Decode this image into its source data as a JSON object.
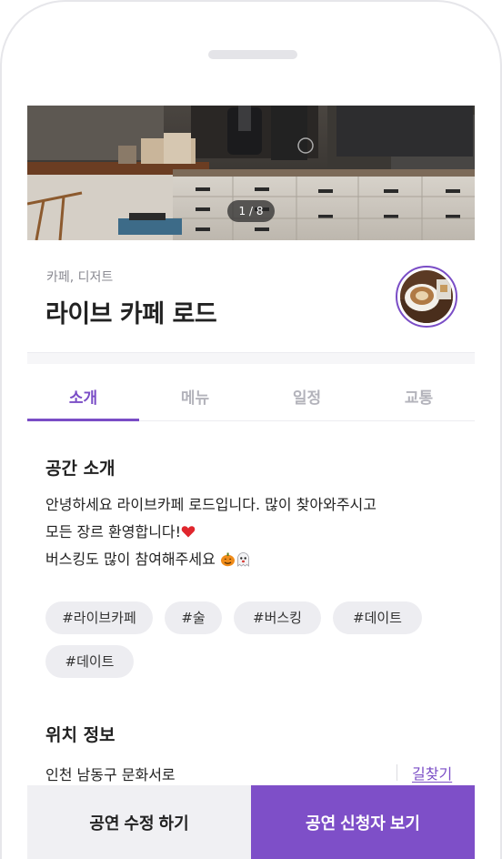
{
  "hero": {
    "counter": "1 / 8"
  },
  "place": {
    "category": "카페, 디저트",
    "name": "라이브 카페 로드"
  },
  "tabs": [
    {
      "label": "소개",
      "active": true
    },
    {
      "label": "메뉴",
      "active": false
    },
    {
      "label": "일정",
      "active": false
    },
    {
      "label": "교통",
      "active": false
    }
  ],
  "intro": {
    "title": "공간 소개",
    "lines": [
      "안녕하세요 라이브카페 로드입니다. 많이 찾아와주시고",
      "모든 장르 환영합니다!",
      "버스킹도 많이 참여해주세요 "
    ],
    "tags": [
      "#라이브카페",
      "#술",
      "#버스킹",
      "#데이트",
      "#데이트"
    ]
  },
  "location": {
    "title": "위치 정보",
    "address": "인천 남동구 문화서로",
    "directions_label": "길찾기"
  },
  "actions": {
    "edit_label": "공연 수정 하기",
    "apply_label": "공연 신청자 보기"
  },
  "colors": {
    "accent": "#7e4fc8",
    "tag_bg": "#ededf1",
    "muted": "#b3b3bb"
  },
  "icons": [
    "heart-emoji-icon",
    "pumpkin-emoji-icon",
    "ghost-emoji-icon"
  ]
}
